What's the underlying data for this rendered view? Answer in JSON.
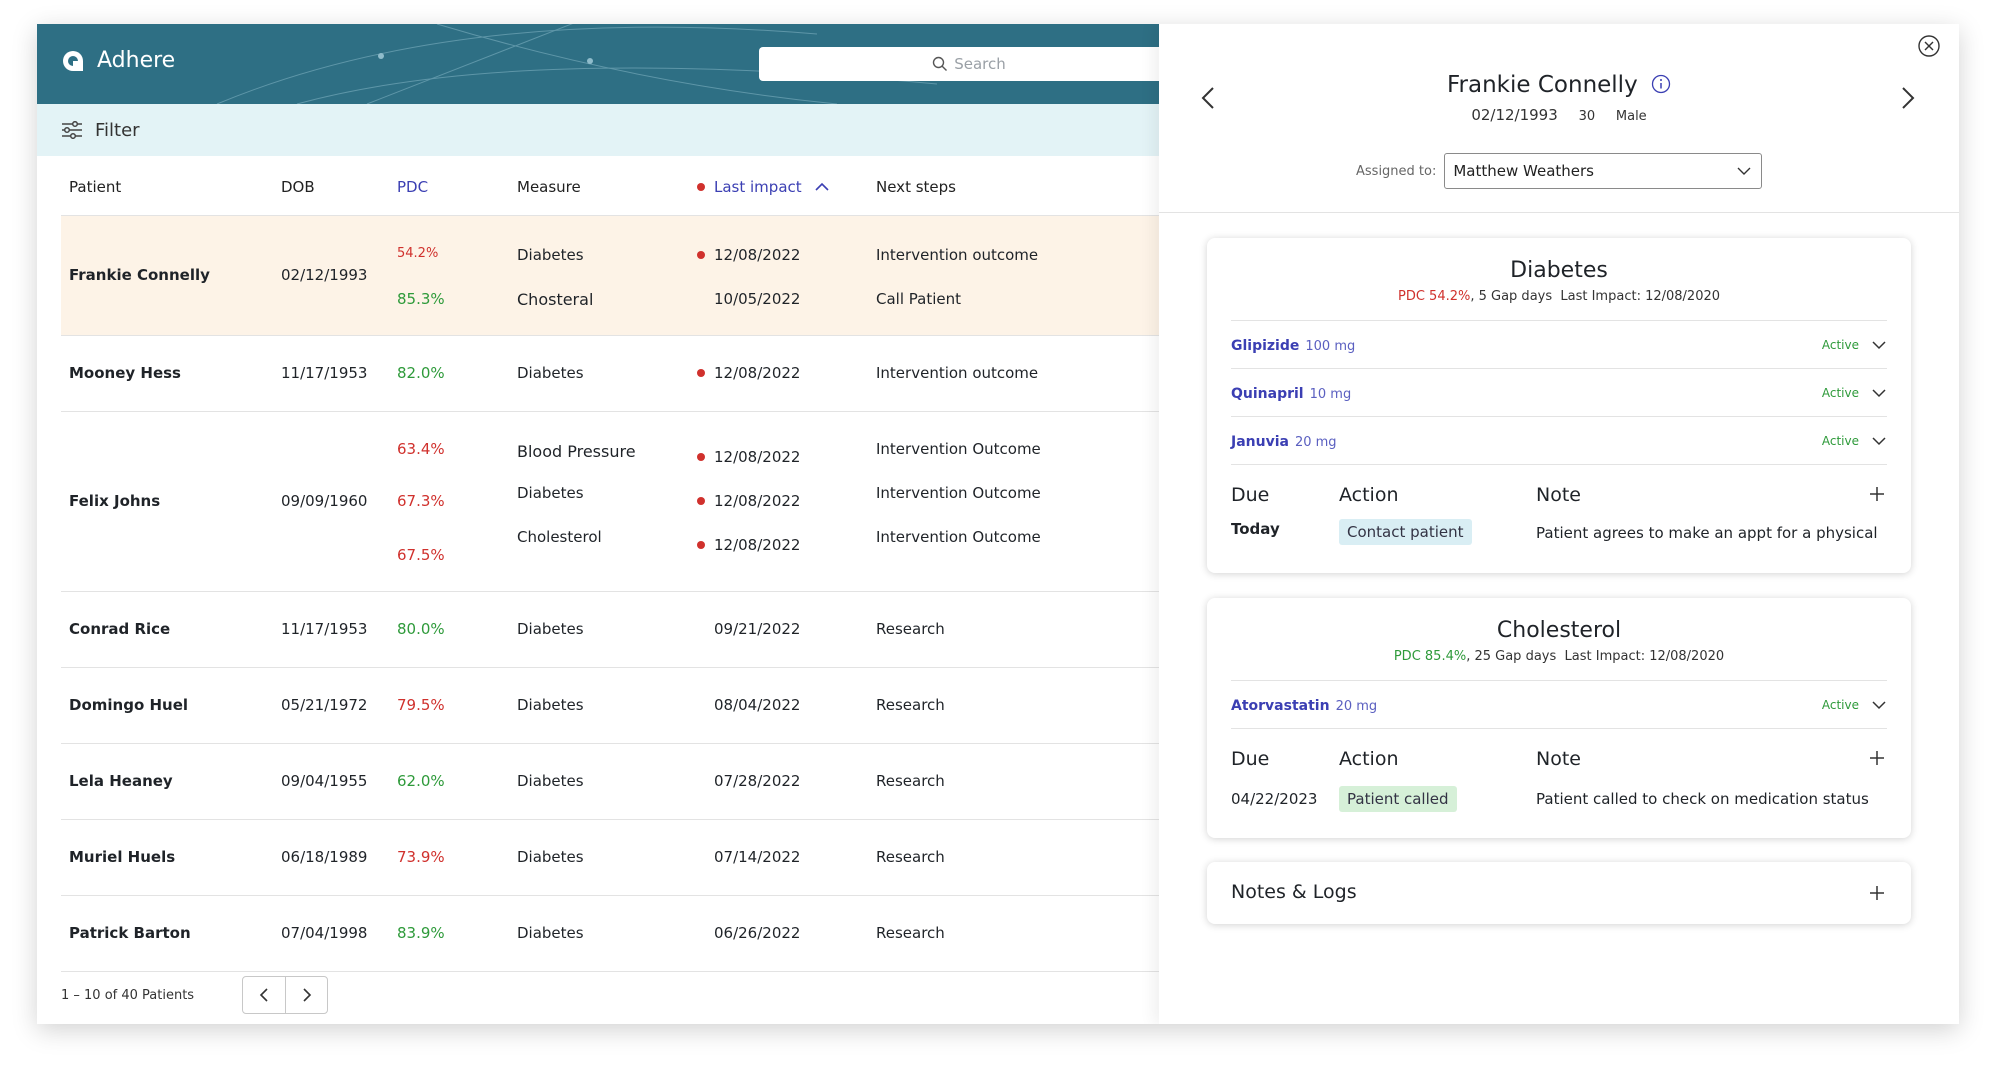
{
  "app": {
    "name": "Adhere"
  },
  "search": {
    "placeholder": "Search"
  },
  "filter": {
    "label": "Filter"
  },
  "table": {
    "headers": {
      "patient": "Patient",
      "dob": "DOB",
      "pdc": "PDC",
      "measure": "Measure",
      "last_impact": "Last impact",
      "next_steps": "Next steps"
    },
    "rows": [
      {
        "name": "Frankie Connelly",
        "dob": "02/12/1993",
        "lines": [
          {
            "pdc": "54.2%",
            "measure": "Diabetes",
            "date": "12/08/2022",
            "next": "Intervention outcome"
          },
          {
            "pdc": "85.3%",
            "measure": "Chosteral",
            "date": "10/05/2022",
            "next": "Call Patient"
          }
        ]
      },
      {
        "name": "Mooney Hess",
        "dob": "11/17/1953",
        "lines": [
          {
            "pdc": "82.0%",
            "measure": "Diabetes",
            "date": "12/08/2022",
            "next": "Intervention outcome"
          }
        ]
      },
      {
        "name": "Felix Johns",
        "dob": "09/09/1960",
        "lines": [
          {
            "pdc": "63.4%",
            "measure": "Blood Pressure",
            "date": "12/08/2022",
            "next": "Intervention Outcome"
          },
          {
            "pdc": "67.3%",
            "measure": "Diabetes",
            "date": "12/08/2022",
            "next": "Intervention Outcome"
          },
          {
            "pdc": "67.5%",
            "measure": "Cholesterol",
            "date": "12/08/2022",
            "next": "Intervention Outcome"
          }
        ]
      },
      {
        "name": "Conrad Rice",
        "dob": "11/17/1953",
        "lines": [
          {
            "pdc": "80.0%",
            "measure": "Diabetes",
            "date": "09/21/2022",
            "next": "Research"
          }
        ]
      },
      {
        "name": "Domingo Huel",
        "dob": "05/21/1972",
        "lines": [
          {
            "pdc": "79.5%",
            "measure": "Diabetes",
            "date": "08/04/2022",
            "next": "Research"
          }
        ]
      },
      {
        "name": "Lela Heaney",
        "dob": "09/04/1955",
        "lines": [
          {
            "pdc": "62.0%",
            "measure": "Diabetes",
            "date": "07/28/2022",
            "next": "Research"
          }
        ]
      },
      {
        "name": "Muriel Huels",
        "dob": "06/18/1989",
        "lines": [
          {
            "pdc": "73.9%",
            "measure": "Diabetes",
            "date": "07/14/2022",
            "next": "Research"
          }
        ]
      },
      {
        "name": "Patrick Barton",
        "dob": "07/04/1998",
        "lines": [
          {
            "pdc": "83.9%",
            "measure": "Diabetes",
            "date": "06/26/2022",
            "next": "Research"
          }
        ]
      }
    ],
    "pagination": "1 – 10 of 40 Patients"
  },
  "panel": {
    "patient_name": "Frankie Connelly",
    "dob": "02/12/1993",
    "age": "30",
    "sex": "Male",
    "assigned_label": "Assigned to:",
    "assigned_value": "Matthew Weathers",
    "cards": {
      "diabetes": {
        "title": "Diabetes",
        "pdc": "PDC 54.2%",
        "gap": ", 5 Gap days",
        "last_impact": "Last Impact: 12/08/2020",
        "meds": [
          {
            "name": "Glipizide",
            "dose": "100 mg",
            "status": "Active"
          },
          {
            "name": "Quinapril",
            "dose": "10 mg",
            "status": "Active"
          },
          {
            "name": "Januvia",
            "dose": "20 mg",
            "status": "Active"
          }
        ],
        "due_header": "Due",
        "action_header": "Action",
        "note_header": "Note",
        "due": "Today",
        "action": "Contact patient",
        "note": "Patient agrees to make an appt for a physical"
      },
      "cholesterol": {
        "title": "Cholesterol",
        "pdc": "PDC 85.4%",
        "gap": ", 25 Gap days",
        "last_impact": "Last Impact: 12/08/2020",
        "meds": [
          {
            "name": "Atorvastatin",
            "dose": "20 mg",
            "status": "Active"
          }
        ],
        "due_header": "Due",
        "action_header": "Action",
        "note_header": "Note",
        "due": "04/22/2023",
        "action": "Patient called",
        "note": "Patient called to check on medication status"
      },
      "notes": {
        "title": "Notes & Logs"
      }
    }
  },
  "colors": {
    "header": "#2e6f84",
    "filterbar": "#e3f3f6",
    "selected_row": "#fdf3e7",
    "accent": "#3b3fb3",
    "danger": "#d0312d",
    "success": "#2e9a3a"
  }
}
